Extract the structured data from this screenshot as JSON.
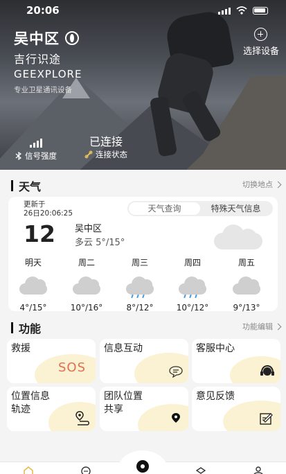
{
  "status_bar": {
    "time": "20:06"
  },
  "header": {
    "location": "吴中区",
    "brand_cn": "吉行识途",
    "brand_en": "GEEXPLORE",
    "brand_sub": "专业卫星通讯设备",
    "select_device": "选择设备",
    "signal_label": "信号强度",
    "connection_value": "已连接",
    "connection_label": "连接状态"
  },
  "weather_section": {
    "title": "天气",
    "link": "切换地点",
    "updated_label": "更新于",
    "updated_time": "26日20:06:25",
    "tabs": [
      "天气查询",
      "特殊天气信息"
    ],
    "current_temp": "12",
    "current_location": "吴中区",
    "current_condition": "多云 5°/15°",
    "forecast": [
      {
        "day": "明天",
        "range": "4°/15°",
        "icon": "cloud-icon"
      },
      {
        "day": "周二",
        "range": "10°/16°",
        "icon": "cloud-icon"
      },
      {
        "day": "周三",
        "range": "8°/12°",
        "icon": "rain-icon"
      },
      {
        "day": "周四",
        "range": "10°/12°",
        "icon": "rain-icon"
      },
      {
        "day": "周五",
        "range": "9°/13°",
        "icon": "cloud-icon"
      }
    ]
  },
  "function_section": {
    "title": "功能",
    "link": "功能编辑",
    "items": [
      {
        "label": "救援",
        "badge": "SOS"
      },
      {
        "label": "信息互动"
      },
      {
        "label": "客服中心"
      },
      {
        "label": "位置信息\n轨迹"
      },
      {
        "label": "团队位置\n共享"
      },
      {
        "label": "意见反馈"
      }
    ]
  },
  "colors": {
    "accent_yellow": "#fbf1d3",
    "sos_red": "#e07050",
    "rain_blue": "#4a9be0"
  }
}
